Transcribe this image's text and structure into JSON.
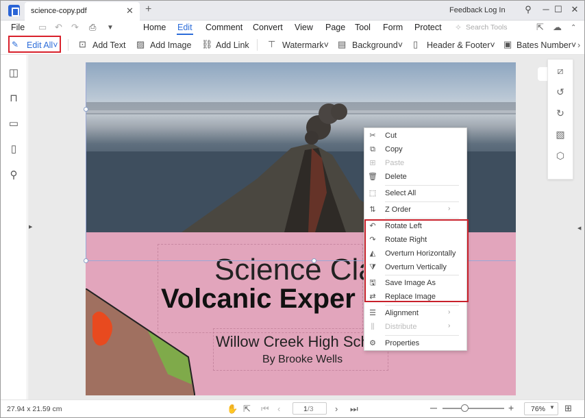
{
  "titlebar": {
    "tab_title": "science-copy.pdf",
    "tab_close": "✕",
    "new_tab": "+",
    "feedback": "Feedback",
    "login": "Log In",
    "window_buttons": [
      "⚲",
      "─",
      "☐",
      "✕"
    ]
  },
  "menubar": {
    "file": "File",
    "items": [
      "Home",
      "Edit",
      "Comment",
      "Convert",
      "View",
      "Page",
      "Tool",
      "Form",
      "Protect"
    ],
    "active": "Edit",
    "search_placeholder": "Search Tools"
  },
  "toolbar": {
    "edit_all": "Edit All",
    "add_text": "Add Text",
    "add_image": "Add Image",
    "add_link": "Add Link",
    "watermark": "Watermark",
    "background": "Background",
    "header_footer": "Header & Footer",
    "bates_number": "Bates Number",
    "dropdown_glyph": "˅",
    "more_glyph": "›"
  },
  "sidebar": {
    "icons": [
      "thumbnails-icon",
      "bookmark-icon",
      "comment-icon",
      "attachment-icon",
      "search-icon"
    ]
  },
  "document": {
    "title_line1": "Science Cla",
    "title_line2": "Volcanic Exper",
    "school": "Willow Creek High Sch",
    "author": "By Brooke Wells",
    "colors": {
      "page_pink": "#e2a5bc",
      "ink": "#111111"
    }
  },
  "right_panel": {
    "icons": [
      "crop-icon",
      "rotate-left-icon",
      "rotate-right-icon",
      "extract-image-icon",
      "replace-image-icon"
    ]
  },
  "context_menu": {
    "items": [
      {
        "label": "Cut",
        "icon": "✂",
        "disabled": false,
        "submenu": false
      },
      {
        "label": "Copy",
        "icon": "⧉",
        "disabled": false,
        "submenu": false
      },
      {
        "label": "Paste",
        "icon": "⊞",
        "disabled": true,
        "submenu": false
      },
      {
        "label": "Delete",
        "icon": "🗑",
        "disabled": false,
        "submenu": false
      },
      {
        "label": "Select All",
        "icon": "⬚",
        "disabled": false,
        "submenu": false
      },
      {
        "label": "Z Order",
        "icon": "⇅",
        "disabled": false,
        "submenu": true
      },
      {
        "label": "Rotate Left",
        "icon": "↶",
        "disabled": false,
        "submenu": false
      },
      {
        "label": "Rotate Right",
        "icon": "↷",
        "disabled": false,
        "submenu": false
      },
      {
        "label": "Overturn Horizontally",
        "icon": "◭",
        "disabled": false,
        "submenu": false
      },
      {
        "label": "Overturn Vertically",
        "icon": "⧩",
        "disabled": false,
        "submenu": false
      },
      {
        "label": "Save Image As",
        "icon": "🖫",
        "disabled": false,
        "submenu": false
      },
      {
        "label": "Replace Image",
        "icon": "⇄",
        "disabled": false,
        "submenu": false
      },
      {
        "label": "Alignment",
        "icon": "☰",
        "disabled": false,
        "submenu": true
      },
      {
        "label": "Distribute",
        "icon": "⫼",
        "disabled": true,
        "submenu": true
      },
      {
        "label": "Properties",
        "icon": "⚙",
        "disabled": false,
        "submenu": false
      }
    ],
    "submenu_glyph": "›",
    "highlight_color": "#c8202a"
  },
  "statusbar": {
    "page_size": "27.94 x 21.59 cm",
    "page_current": "1",
    "page_total": "/3",
    "zoom": "76%",
    "zoom_level": 0.3
  }
}
